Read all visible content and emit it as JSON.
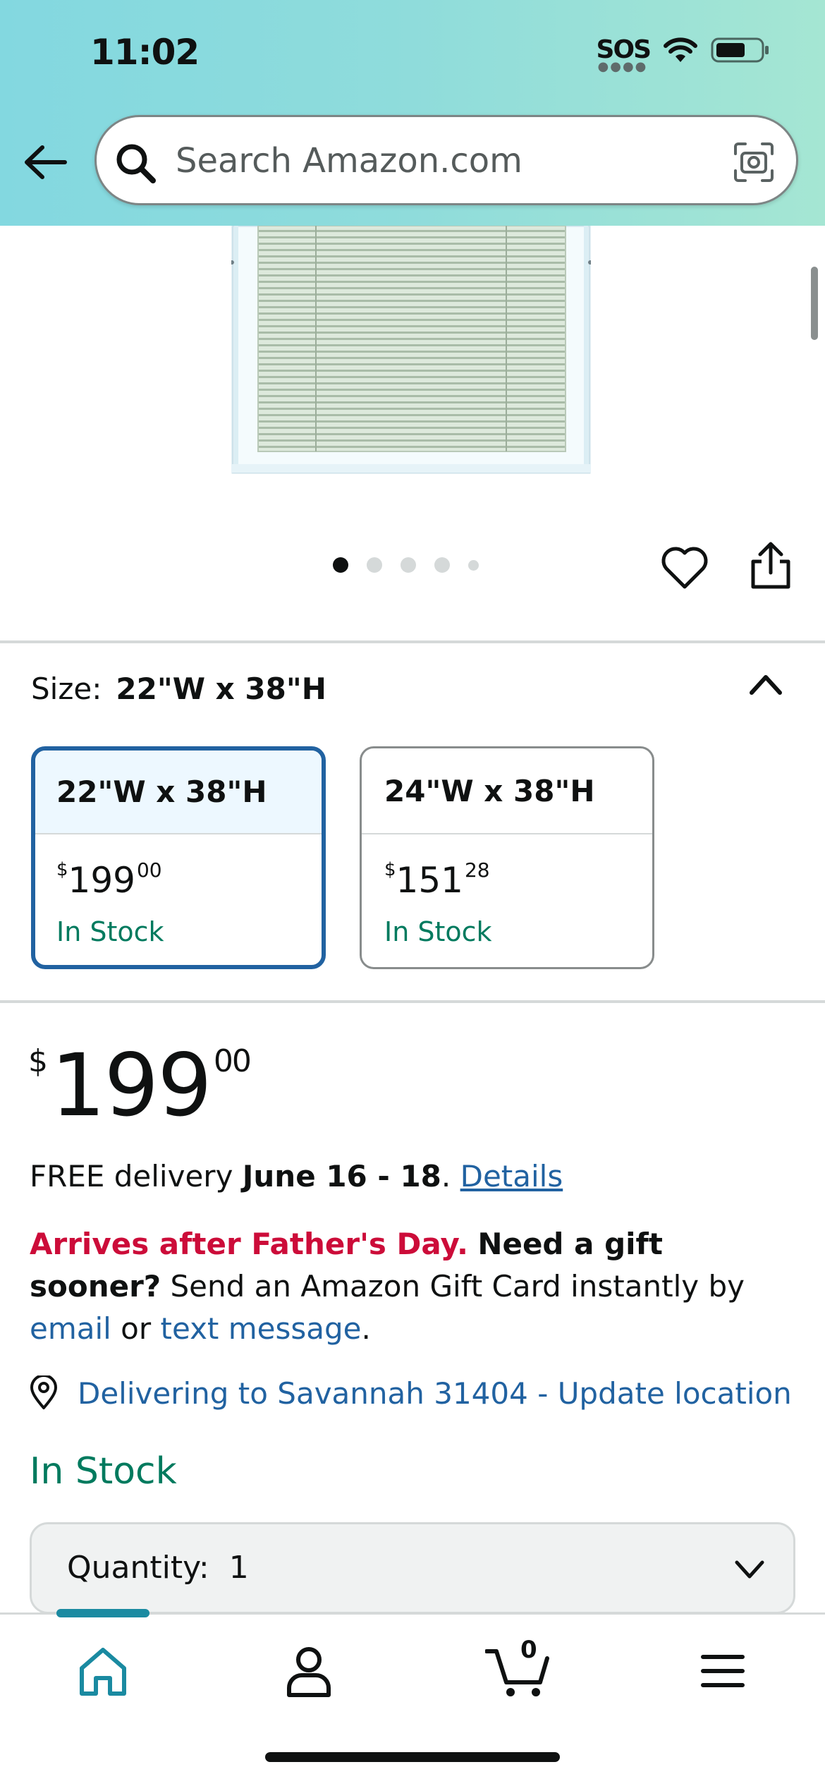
{
  "status_bar": {
    "time": "11:02",
    "sos": "SOS"
  },
  "search": {
    "placeholder": "Search Amazon.com"
  },
  "gallery": {
    "image_count": 5,
    "active_index": 0
  },
  "size_selector": {
    "label": "Size:",
    "selected_value": "22\"W x 38\"H",
    "options": [
      {
        "name": "22\"W x 38\"H",
        "price_currency": "$",
        "price_whole": "199",
        "price_cents": "00",
        "stock": "In Stock",
        "selected": true
      },
      {
        "name": "24\"W x 38\"H",
        "price_currency": "$",
        "price_whole": "151",
        "price_cents": "28",
        "stock": "In Stock",
        "selected": false
      }
    ]
  },
  "price": {
    "currency": "$",
    "whole": "199",
    "cents": "00"
  },
  "delivery": {
    "prefix": "FREE delivery ",
    "dates": "June 16 - 18",
    "period": ".",
    "details_link": "Details"
  },
  "gift": {
    "warning": "Arrives after Father's Day.",
    "question": "Need a gift sooner?",
    "text1": " Send an Amazon Gift Card instantly by ",
    "email_link": "email",
    "or": " or ",
    "text_link": "text message",
    "end": "."
  },
  "location": {
    "text": "Delivering to Savannah 31404 - Update location"
  },
  "availability": "In Stock",
  "quantity": {
    "label": "Quantity:",
    "value": "1"
  },
  "bottom_nav": {
    "cart_count": "0"
  },
  "colors": {
    "accent_blue": "#2162a1",
    "stock_green": "#007a5e",
    "alert_red": "#cc0c39",
    "nav_indicator": "#1a8aa1"
  }
}
